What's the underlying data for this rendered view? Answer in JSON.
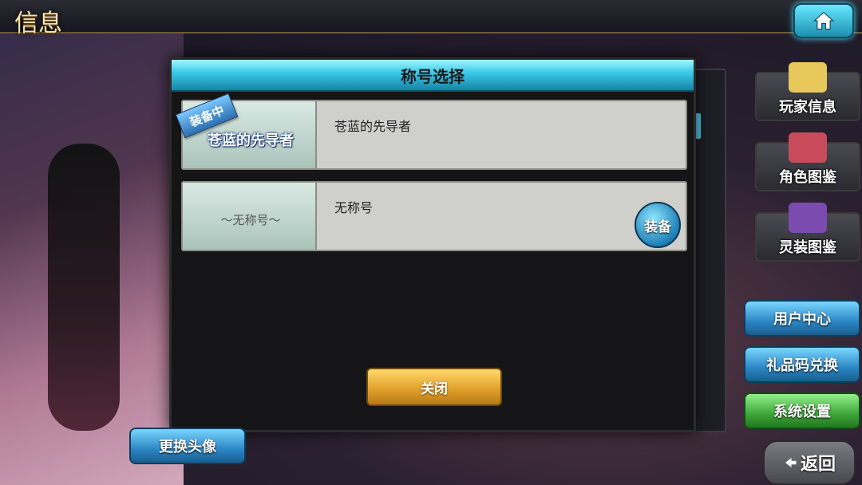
{
  "screen": {
    "title": "信息"
  },
  "modal": {
    "title": "称号选择",
    "rows": [
      {
        "badge_tag": "装备中",
        "title_art_text": "苍蓝的先导者",
        "name": "苍蓝的先导者"
      },
      {
        "title_art_text": "〜无称号〜",
        "name": "无称号",
        "action_label": "装备"
      }
    ],
    "close_label": "关闭"
  },
  "side_menu": {
    "cards": [
      {
        "label": "玩家信息",
        "icon": "player-info-icon",
        "color": "#e9c85b"
      },
      {
        "label": "角色图鉴",
        "icon": "character-book-icon",
        "color": "#c74b5b"
      },
      {
        "label": "灵装图鉴",
        "icon": "equipment-book-icon",
        "color": "#7b4bb0"
      }
    ],
    "buttons": [
      {
        "label": "用户中心",
        "style": "blue"
      },
      {
        "label": "礼品码兑换",
        "style": "blue"
      },
      {
        "label": "系统设置",
        "style": "green"
      }
    ]
  },
  "bottom": {
    "change_avatar": "更换头像",
    "back": "返回"
  }
}
